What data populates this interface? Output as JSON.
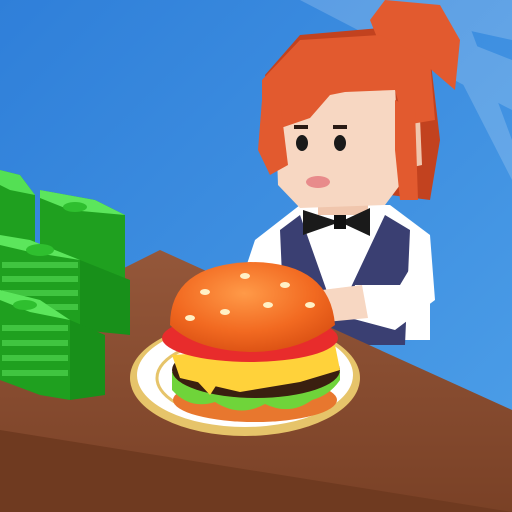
{
  "scene": {
    "description_name": "burger-shop-game-icon",
    "colors": {
      "sky_top": "#2f7fd9",
      "sky_bottom": "#5aa8f0",
      "counter_top": "#8b4f2e",
      "counter_front": "#6f3a20",
      "hair": "#e25a2f",
      "hair_dark": "#c2421f",
      "skin": "#f7d7c2",
      "shirt": "#ffffff",
      "vest": "#3a3f72",
      "bowtie": "#1a1a1a",
      "cash_green": "#3fd43f",
      "cash_dark": "#1fa01f",
      "bun": "#f26a21",
      "bun_light": "#ff8a3a",
      "seed": "#fff1c6",
      "tomato": "#e82c2c",
      "cheese": "#ffd23a",
      "patty": "#3a1f10",
      "lettuce": "#6fd43a",
      "plate": "#ffffff",
      "plate_rim": "#e6c46a"
    },
    "icons": {
      "character": "waitress-character-icon",
      "cash": "cash-stack-icon",
      "food": "burger-icon",
      "dish": "plate-icon"
    }
  }
}
